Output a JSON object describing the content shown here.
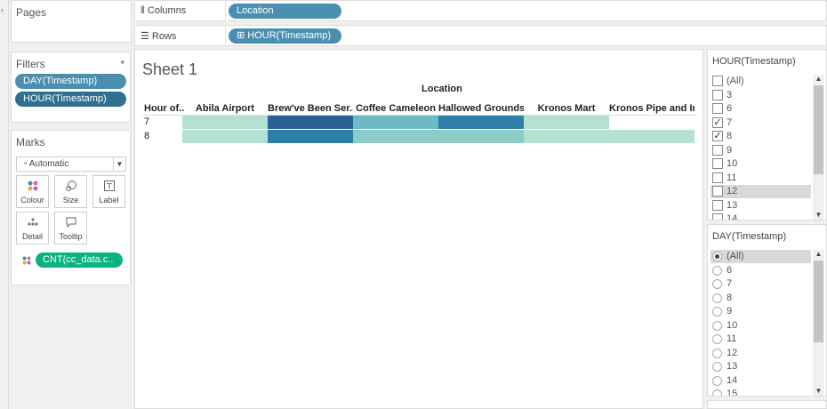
{
  "shelves": {
    "columns": {
      "name": "Columns",
      "pill": "Location"
    },
    "rows": {
      "name": "Rows",
      "pill": "HOUR(Timestamp)"
    }
  },
  "pages": {
    "title": "Pages"
  },
  "filters": {
    "title": "Filters",
    "items": [
      {
        "label": "DAY(Timestamp)",
        "color": "#4a8fb0"
      },
      {
        "label": "HOUR(Timestamp)",
        "color": "#2f6f8f"
      }
    ]
  },
  "marks": {
    "title": "Marks",
    "type": "Automatic",
    "buttons": [
      {
        "label": "Colour",
        "icon": "colour-dots-icon"
      },
      {
        "label": "Size",
        "icon": "size-icon"
      },
      {
        "label": "Label",
        "icon": "label-icon"
      },
      {
        "label": "Detail",
        "icon": "detail-icon"
      },
      {
        "label": "Tooltip",
        "icon": "tooltip-icon"
      }
    ],
    "measure_pill": "CNT(cc_data.c.."
  },
  "sheet": {
    "title": "Sheet 1",
    "column_group_title": "Location",
    "row_header": "Hour of..",
    "columns": [
      "Abila Airport",
      "Brew've Been Ser..",
      "Coffee Cameleon",
      "Hallowed Grounds",
      "Kronos Mart",
      "Kronos Pipe and Ir.."
    ],
    "rows": [
      "7",
      "8"
    ],
    "palette": {
      "lightest": "#b5e0d4",
      "light": "#8ccbc6",
      "mid": "#6bbac6",
      "dark": "#2f7ea7",
      "darkest": "#2c5f92"
    },
    "cells": [
      [
        "lightest",
        "darkest",
        "mid",
        "dark",
        "lightest",
        "none"
      ],
      [
        "lightest",
        "dark",
        "light",
        "light",
        "lightest",
        "lightest"
      ]
    ]
  },
  "hour_filter": {
    "title": "HOUR(Timestamp)",
    "options": [
      {
        "label": "(All)",
        "checked": false
      },
      {
        "label": "3",
        "checked": false
      },
      {
        "label": "6",
        "checked": false
      },
      {
        "label": "7",
        "checked": true
      },
      {
        "label": "8",
        "checked": true
      },
      {
        "label": "9",
        "checked": false
      },
      {
        "label": "10",
        "checked": false
      },
      {
        "label": "11",
        "checked": false
      },
      {
        "label": "12",
        "checked": false,
        "highlight": true
      },
      {
        "label": "13",
        "checked": false
      },
      {
        "label": "14",
        "checked": false
      }
    ]
  },
  "day_filter": {
    "title": "DAY(Timestamp)",
    "options": [
      {
        "label": "(All)",
        "checked": true,
        "highlight": true
      },
      {
        "label": "6",
        "checked": false
      },
      {
        "label": "7",
        "checked": false
      },
      {
        "label": "8",
        "checked": false
      },
      {
        "label": "9",
        "checked": false
      },
      {
        "label": "10",
        "checked": false
      },
      {
        "label": "11",
        "checked": false
      },
      {
        "label": "12",
        "checked": false
      },
      {
        "label": "13",
        "checked": false
      },
      {
        "label": "14",
        "checked": false
      },
      {
        "label": "15",
        "checked": false
      }
    ]
  }
}
